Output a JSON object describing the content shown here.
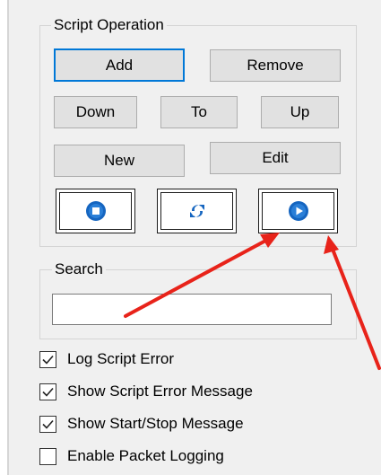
{
  "script_operation": {
    "title": "Script Operation",
    "add_label": "Add",
    "remove_label": "Remove",
    "down_label": "Down",
    "to_label": "To",
    "up_label": "Up",
    "new_label": "New",
    "edit_label": "Edit",
    "icons": {
      "stop": "stop-icon",
      "refresh": "refresh-icon",
      "play": "play-icon"
    }
  },
  "search": {
    "title": "Search",
    "value": "",
    "placeholder": ""
  },
  "options": [
    {
      "label": "Log Script Error",
      "checked": true
    },
    {
      "label": "Show Script Error Message",
      "checked": true
    },
    {
      "label": "Show Start/Stop Message",
      "checked": true
    },
    {
      "label": "Enable Packet Logging",
      "checked": false
    }
  ],
  "colors": {
    "accent": "#0078d7",
    "icon_blue": "#1565c0",
    "annotation_arrow": "#e8231a"
  }
}
